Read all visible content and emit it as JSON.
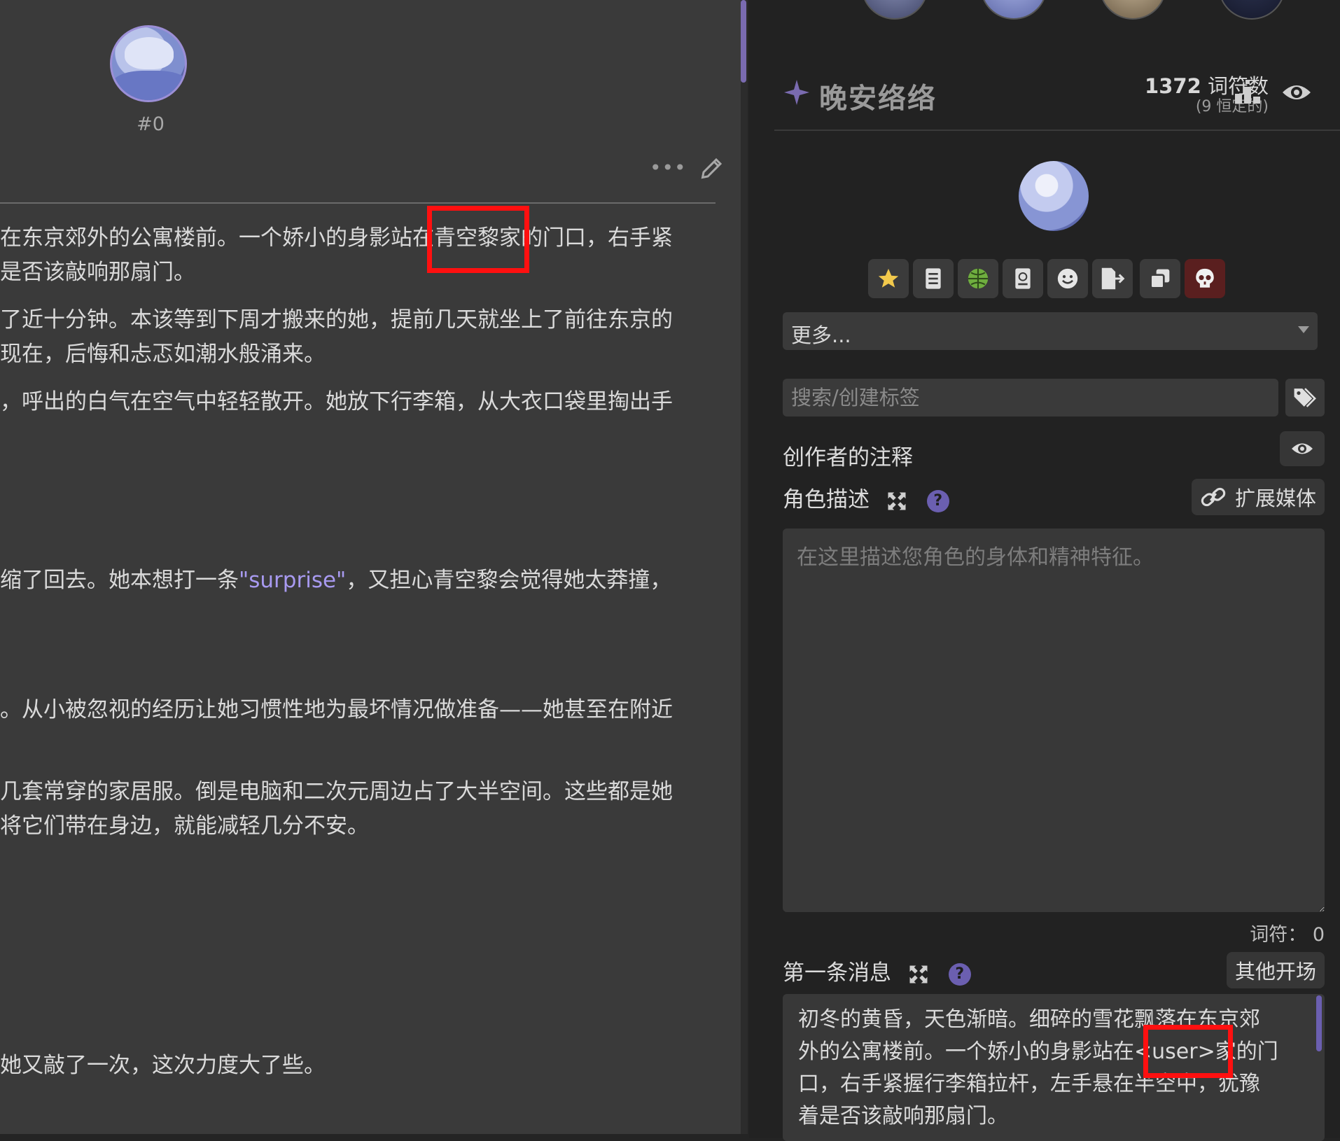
{
  "chat": {
    "message_index": "#0",
    "lines": [
      {
        "text": "在东京郊外的公寓楼前。一个娇小的身影站在青空黎家的门口，右手紧"
      },
      {
        "text": "是否该敲响那扇门。"
      },
      {
        "text": "了近十分钟。本该等到下周才搬来的她，提前几天就坐上了前往东京的"
      },
      {
        "text": "现在，后悔和忐忑如潮水般涌来。"
      },
      {
        "text": "，呼出的白气在空气中轻轻散开。她放下行李箱，从大衣口袋里掏出手"
      },
      {
        "before": "缩了回去。她本想打一条",
        "quote": "\"surprise\"",
        "after": "，又担心青空黎会觉得她太莽撞，"
      },
      {
        "text": "。从小被忽视的经历让她习惯性地为最坏情况做准备——她甚至在附近"
      },
      {
        "text": "几套常穿的家居服。倒是电脑和二次元周边占了大半空间。这些都是她"
      },
      {
        "text": "将它们带在身边，就能减轻几分不安。"
      },
      {
        "text": "她又敲了一次，这次力度大了些。"
      }
    ]
  },
  "character": {
    "name": "晚安络络",
    "token_count": "1372",
    "token_label": "词符数",
    "permanent_tokens": "(9 恒定的)"
  },
  "toolbar_icons": [
    "star-icon",
    "book-icon",
    "globe-icon",
    "passport-icon",
    "smile-icon",
    "export-icon",
    "duplicate-icon",
    "skull-icon"
  ],
  "more_select": {
    "value": "更多..."
  },
  "tag_search": {
    "placeholder": "搜索/创建标签"
  },
  "creator_notes": {
    "label": "创作者的注释"
  },
  "description": {
    "label": "角色描述",
    "help": "?",
    "expand_media_label": "扩展媒体",
    "placeholder": "在这里描述您角色的身体和精神特征。",
    "token_text": "词符：  0"
  },
  "first_message": {
    "label": "第一条消息",
    "help": "?",
    "alt_greetings_label": "其他开场",
    "lines": [
      "初冬的黄昏，天色渐暗。细碎的雪花飘落在东京郊",
      "外的公寓楼前。一个娇小的身影站在<user>家的门",
      "口，右手紧握行李箱拉杆，左手悬在半空中，犹豫",
      "着是否该敲响那扇门。"
    ]
  },
  "colors": {
    "accent": "#7a6bb0",
    "highlight_box": "#ff1010",
    "quote": "#a89af0",
    "danger": "#5a1f1f"
  }
}
